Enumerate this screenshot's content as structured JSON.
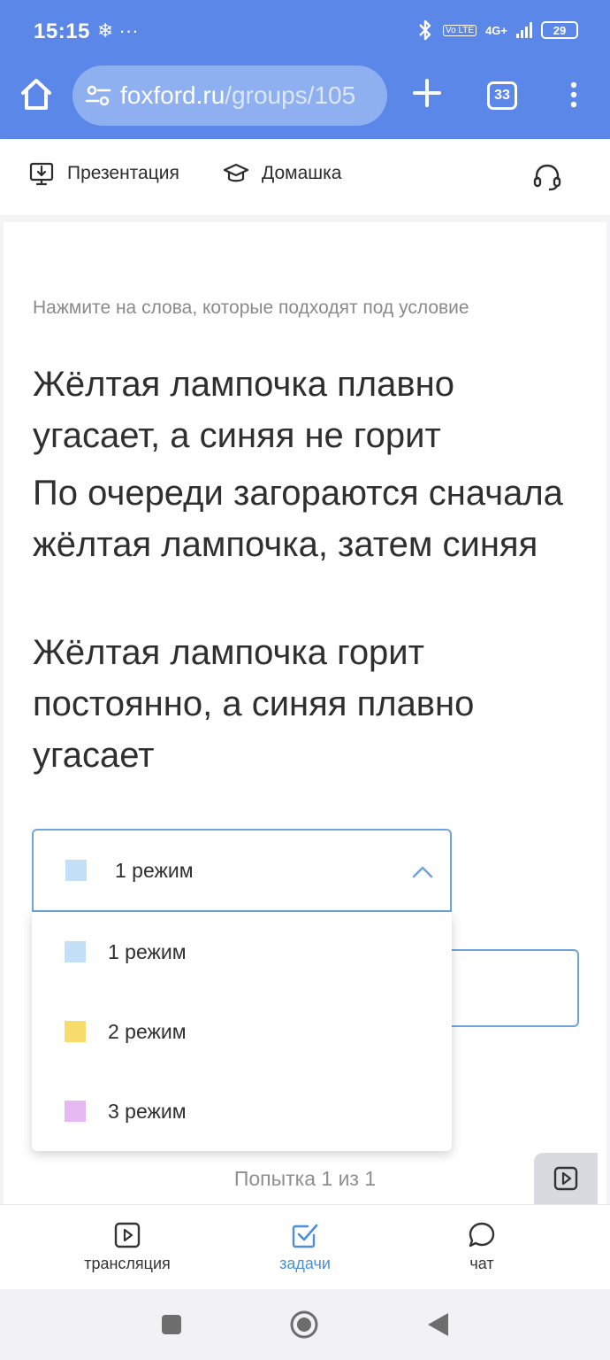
{
  "status_bar": {
    "time": "15:15",
    "left_icons": "❄ ···",
    "network": "4G+",
    "volte": "Vo LTE",
    "battery": "29"
  },
  "browser": {
    "url_domain": "foxford.ru",
    "url_path": "/groups/105",
    "tab_count": "33"
  },
  "toolbar": {
    "presentation_label": "Презентация",
    "homework_label": "Домашка"
  },
  "task": {
    "instruction": "Нажмите на слова, которые подходят под условие",
    "statements": [
      "Жёлтая лампочка плавно угасает, а синяя не горит",
      "По очереди загораются сначала жёлтая лампочка, затем синяя",
      "Жёлтая лампочка горит постоянно, а синяя плавно угасает"
    ],
    "select": {
      "selected_label": "1 режим",
      "selected_color": "#c4e0f9"
    },
    "options": [
      {
        "label": "1 режим",
        "color": "#c4e0f9"
      },
      {
        "label": "2 режим",
        "color": "#f7dc6b"
      },
      {
        "label": "3 режим",
        "color": "#e6b9f3"
      }
    ],
    "attempt_text": "Попытка 1 из 1"
  },
  "bottom_nav": {
    "stream_label": "трансляция",
    "tasks_label": "задачи",
    "chat_label": "чат",
    "active_color": "#4a8fdc"
  },
  "colors": {
    "chrome": "#5b87e8",
    "accent_border": "#6fa4dc"
  }
}
